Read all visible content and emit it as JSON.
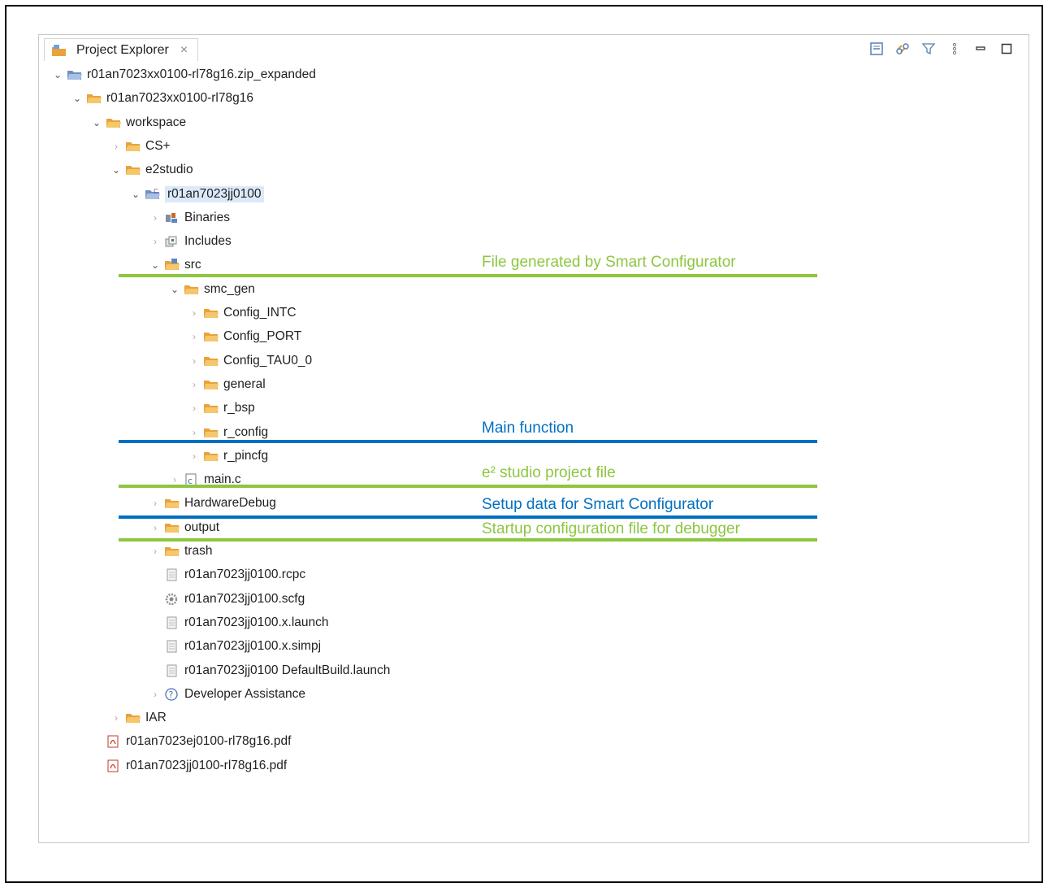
{
  "colors": {
    "green": "#8dc63f",
    "blue": "#0070c0",
    "folder": "#e8a33b",
    "selection": "#dbe9f9"
  },
  "tab": {
    "title": "Project Explorer",
    "close": "×",
    "icon": "project-explorer-icon"
  },
  "toolbar": {
    "icons": [
      "collapse-all-icon",
      "link-with-editor-icon",
      "filter-icon",
      "view-menu-icon",
      "minimize-icon",
      "maximize-icon"
    ]
  },
  "tree": [
    {
      "label": "r01an7023xx0100-rl78g16.zip_expanded",
      "icon": "project-folder-icon",
      "twisty": "open"
    },
    {
      "label": "r01an7023xx0100-rl78g16",
      "icon": "folder-icon",
      "twisty": "open"
    },
    {
      "label": "workspace",
      "icon": "folder-icon",
      "twisty": "open"
    },
    {
      "label": "CS+",
      "icon": "folder-icon",
      "twisty": "closed"
    },
    {
      "label": "e2studio",
      "icon": "folder-icon",
      "twisty": "open"
    },
    {
      "label": "r01an7023jj0100",
      "icon": "c-project-icon",
      "twisty": "open",
      "selected": true
    },
    {
      "label": "Binaries",
      "icon": "binaries-icon",
      "twisty": "closed"
    },
    {
      "label": "Includes",
      "icon": "includes-icon",
      "twisty": "closed"
    },
    {
      "label": "src",
      "icon": "source-folder-icon",
      "twisty": "open"
    },
    {
      "label": "smc_gen",
      "icon": "folder-icon",
      "twisty": "open"
    },
    {
      "label": "Config_INTC",
      "icon": "folder-icon",
      "twisty": "closed"
    },
    {
      "label": "Config_PORT",
      "icon": "folder-icon",
      "twisty": "closed"
    },
    {
      "label": "Config_TAU0_0",
      "icon": "folder-icon",
      "twisty": "closed"
    },
    {
      "label": "general",
      "icon": "folder-icon",
      "twisty": "closed"
    },
    {
      "label": "r_bsp",
      "icon": "folder-icon",
      "twisty": "closed"
    },
    {
      "label": "r_config",
      "icon": "folder-icon",
      "twisty": "closed"
    },
    {
      "label": "r_pincfg",
      "icon": "folder-icon",
      "twisty": "closed"
    },
    {
      "label": "main.c",
      "icon": "c-file-icon",
      "twisty": "closed"
    },
    {
      "label": "HardwareDebug",
      "icon": "folder-icon",
      "twisty": "closed"
    },
    {
      "label": "output",
      "icon": "folder-icon",
      "twisty": "closed"
    },
    {
      "label": "trash",
      "icon": "folder-icon",
      "twisty": "closed"
    },
    {
      "label": "r01an7023jj0100.rcpc",
      "icon": "file-icon",
      "twisty": "none"
    },
    {
      "label": "r01an7023jj0100.scfg",
      "icon": "gear-file-icon",
      "twisty": "none"
    },
    {
      "label": "r01an7023jj0100.x.launch",
      "icon": "file-icon",
      "twisty": "none"
    },
    {
      "label": "r01an7023jj0100.x.simpj",
      "icon": "file-icon",
      "twisty": "none"
    },
    {
      "label": "r01an7023jj0100 DefaultBuild.launch",
      "icon": "file-icon",
      "twisty": "none"
    },
    {
      "label": "Developer Assistance",
      "icon": "help-icon",
      "twisty": "closed"
    },
    {
      "label": "IAR",
      "icon": "folder-icon",
      "twisty": "closed"
    },
    {
      "label": "r01an7023ej0100-rl78g16.pdf",
      "icon": "pdf-icon",
      "twisty": "none"
    },
    {
      "label": "r01an7023jj0100-rl78g16.pdf",
      "icon": "pdf-icon",
      "twisty": "none"
    }
  ],
  "annotations": [
    {
      "text": "File generated by Smart Configurator",
      "color": "green"
    },
    {
      "text": "Main function",
      "color": "blue"
    },
    {
      "text": "e² studio project file",
      "color": "green"
    },
    {
      "text": "Setup data for Smart Configurator",
      "color": "blue"
    },
    {
      "text": "Startup configuration file for debugger",
      "color": "green"
    }
  ]
}
